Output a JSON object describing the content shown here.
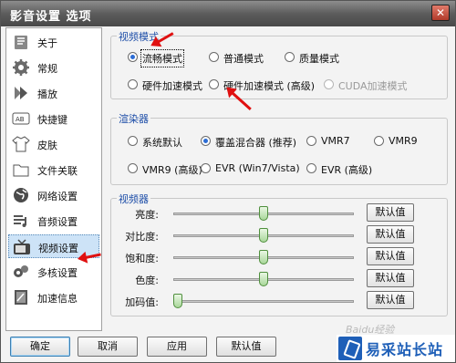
{
  "window": {
    "title": "影音设置 选项",
    "close_glyph": "✕"
  },
  "sidebar": {
    "items": [
      {
        "label": "关于",
        "icon": "about-icon"
      },
      {
        "label": "常规",
        "icon": "gear-icon"
      },
      {
        "label": "播放",
        "icon": "play-icon"
      },
      {
        "label": "快捷键",
        "icon": "keyboard-icon"
      },
      {
        "label": "皮肤",
        "icon": "shirt-icon"
      },
      {
        "label": "文件关联",
        "icon": "folder-icon"
      },
      {
        "label": "网络设置",
        "icon": "globe-icon"
      },
      {
        "label": "音频设置",
        "icon": "audio-icon"
      },
      {
        "label": "视频设置",
        "icon": "tv-icon",
        "active": true
      },
      {
        "label": "多核设置",
        "icon": "cpu-icon"
      },
      {
        "label": "加速信息",
        "icon": "accelerate-icon"
      }
    ]
  },
  "video_mode": {
    "title": "视频模式",
    "options": [
      {
        "label": "流畅模式",
        "checked": true
      },
      {
        "label": "普通模式"
      },
      {
        "label": "质量模式"
      },
      {
        "label": "硬件加速模式"
      },
      {
        "label": "硬件加速模式 (高级)"
      },
      {
        "label": "CUDA加速模式",
        "disabled": true
      }
    ]
  },
  "renderer": {
    "title": "渲染器",
    "options": [
      {
        "label": "系统默认"
      },
      {
        "label": "覆盖混合器 (推荐)",
        "checked": true
      },
      {
        "label": "VMR7"
      },
      {
        "label": "VMR9"
      },
      {
        "label": "VMR9 (高级)"
      },
      {
        "label": "EVR (Win7/Vista)"
      },
      {
        "label": "EVR (高级)"
      }
    ]
  },
  "video_adjust": {
    "title": "视频器",
    "default_label": "默认值",
    "sliders": [
      {
        "label": "亮度:",
        "value": 0.5
      },
      {
        "label": "对比度:",
        "value": 0.5
      },
      {
        "label": "饱和度:",
        "value": 0.5
      },
      {
        "label": "色度:",
        "value": 0.5
      },
      {
        "label": "加码值:",
        "value": 0.0
      }
    ]
  },
  "buttons": {
    "ok": "确定",
    "cancel": "取消",
    "apply": "应用",
    "default": "默认值"
  },
  "watermark": {
    "site": "易采站长站",
    "faint": "Baidu经验"
  },
  "colors": {
    "annotation_arrow": "#e01010",
    "group_title": "#1f4fa8",
    "radio_on": "#2b6cd4"
  }
}
